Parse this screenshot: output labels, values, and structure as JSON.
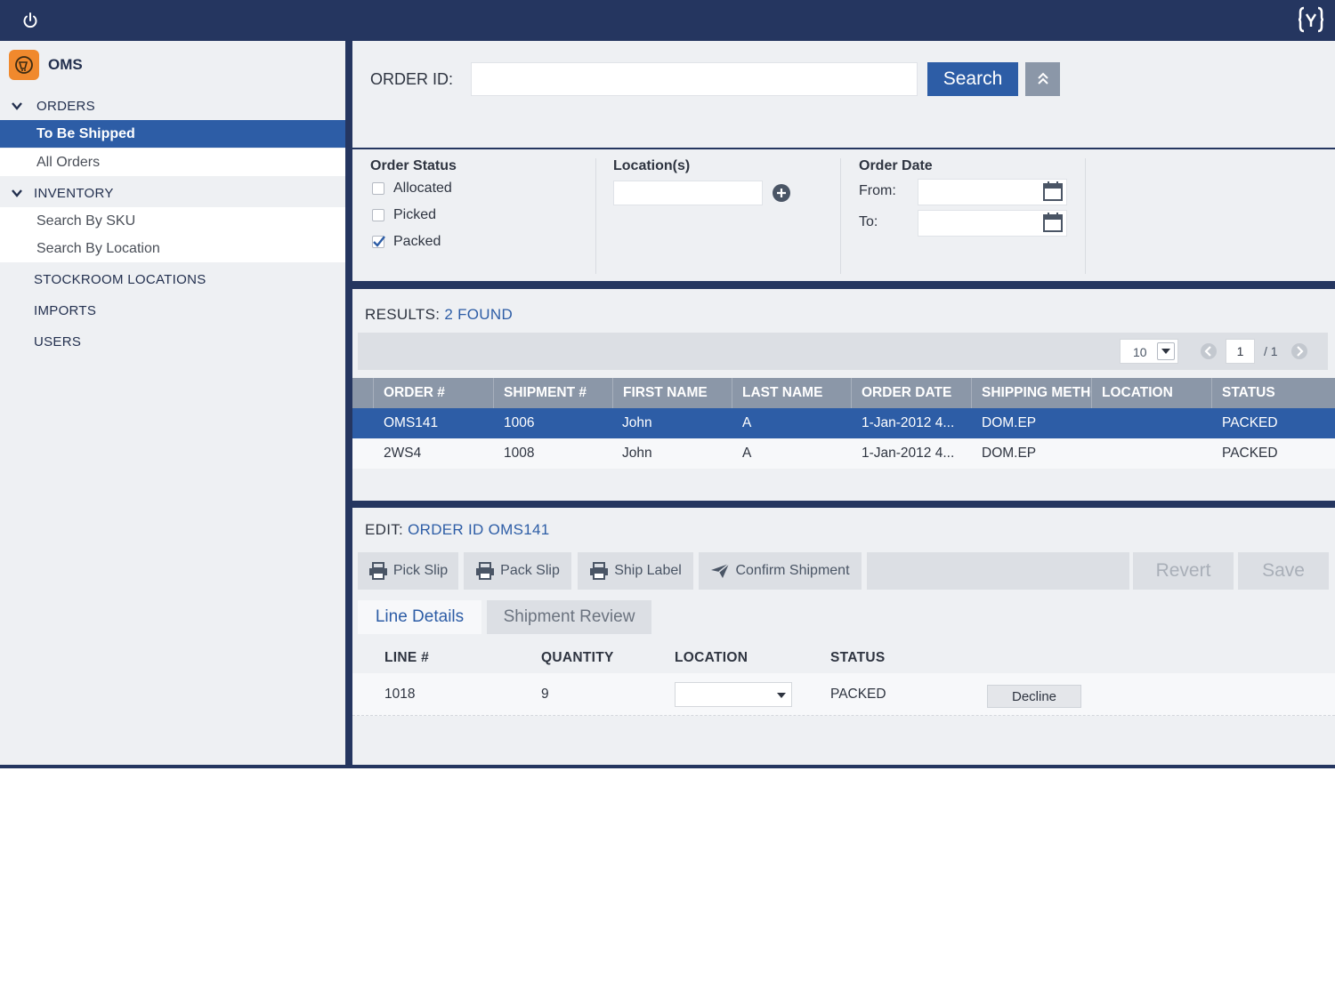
{
  "app": {
    "name": "OMS"
  },
  "sidebar": {
    "sections": [
      {
        "label": "ORDERS",
        "items": [
          {
            "label": "To Be Shipped",
            "active": true
          },
          {
            "label": "All Orders",
            "active": false
          }
        ]
      },
      {
        "label": "INVENTORY",
        "items": [
          {
            "label": "Search By SKU",
            "active": false
          },
          {
            "label": "Search By Location",
            "active": false
          }
        ]
      }
    ],
    "links": [
      "STOCKROOM LOCATIONS",
      "IMPORTS",
      "USERS"
    ]
  },
  "search": {
    "order_id_label": "ORDER ID:",
    "order_id_value": "",
    "button_label": "Search"
  },
  "filters": {
    "order_status": {
      "title": "Order Status",
      "options": [
        {
          "label": "Allocated",
          "checked": false
        },
        {
          "label": "Picked",
          "checked": false
        },
        {
          "label": "Packed",
          "checked": true
        }
      ]
    },
    "locations": {
      "title": "Location(s)",
      "value": ""
    },
    "order_date": {
      "title": "Order Date",
      "from_label": "From:",
      "to_label": "To:",
      "from_value": "",
      "to_value": ""
    }
  },
  "results": {
    "title_prefix": "RESULTS:",
    "count_text": "2 FOUND",
    "page_size": "10",
    "page": "1",
    "page_total": "/ 1",
    "columns": [
      "ORDER #",
      "SHIPMENT #",
      "FIRST NAME",
      "LAST NAME",
      "ORDER DATE",
      "SHIPPING METHOD",
      "LOCATION",
      "STATUS"
    ],
    "rows": [
      {
        "order": "OMS141",
        "shipment": "1006",
        "first": "John",
        "last": "A",
        "date": "1-Jan-2012 4...",
        "method": "DOM.EP",
        "location": "",
        "status": "PACKED",
        "selected": true
      },
      {
        "order": "2WS4",
        "shipment": "1008",
        "first": "John",
        "last": "A",
        "date": "1-Jan-2012 4...",
        "method": "DOM.EP",
        "location": "",
        "status": "PACKED",
        "selected": false
      }
    ]
  },
  "edit": {
    "title_prefix": "EDIT:",
    "order_ref": "ORDER ID OMS141",
    "toolbar": {
      "pick_slip": "Pick Slip",
      "pack_slip": "Pack Slip",
      "ship_label": "Ship Label",
      "confirm": "Confirm Shipment",
      "revert": "Revert",
      "save": "Save"
    },
    "tabs": {
      "line_details": "Line Details",
      "shipment_review": "Shipment Review"
    },
    "line_columns": [
      "LINE #",
      "QUANTITY",
      "LOCATION",
      "STATUS"
    ],
    "lines": [
      {
        "line": "1018",
        "quantity": "9",
        "location": "",
        "status": "PACKED",
        "action": "Decline"
      }
    ]
  },
  "colors": {
    "navy": "#253660",
    "accent": "#2d5da6",
    "header_gray": "#8b97a8",
    "logo_orange": "#f0892d"
  },
  "icons": [
    "power-icon",
    "brand-logo-icon",
    "oms-logo-icon",
    "chevron-down-icon",
    "chevron-double-up-icon",
    "add-circle-icon",
    "calendar-icon",
    "printer-icon",
    "send-icon",
    "dropdown-arrow-icon",
    "prev-page-icon",
    "next-page-icon"
  ]
}
